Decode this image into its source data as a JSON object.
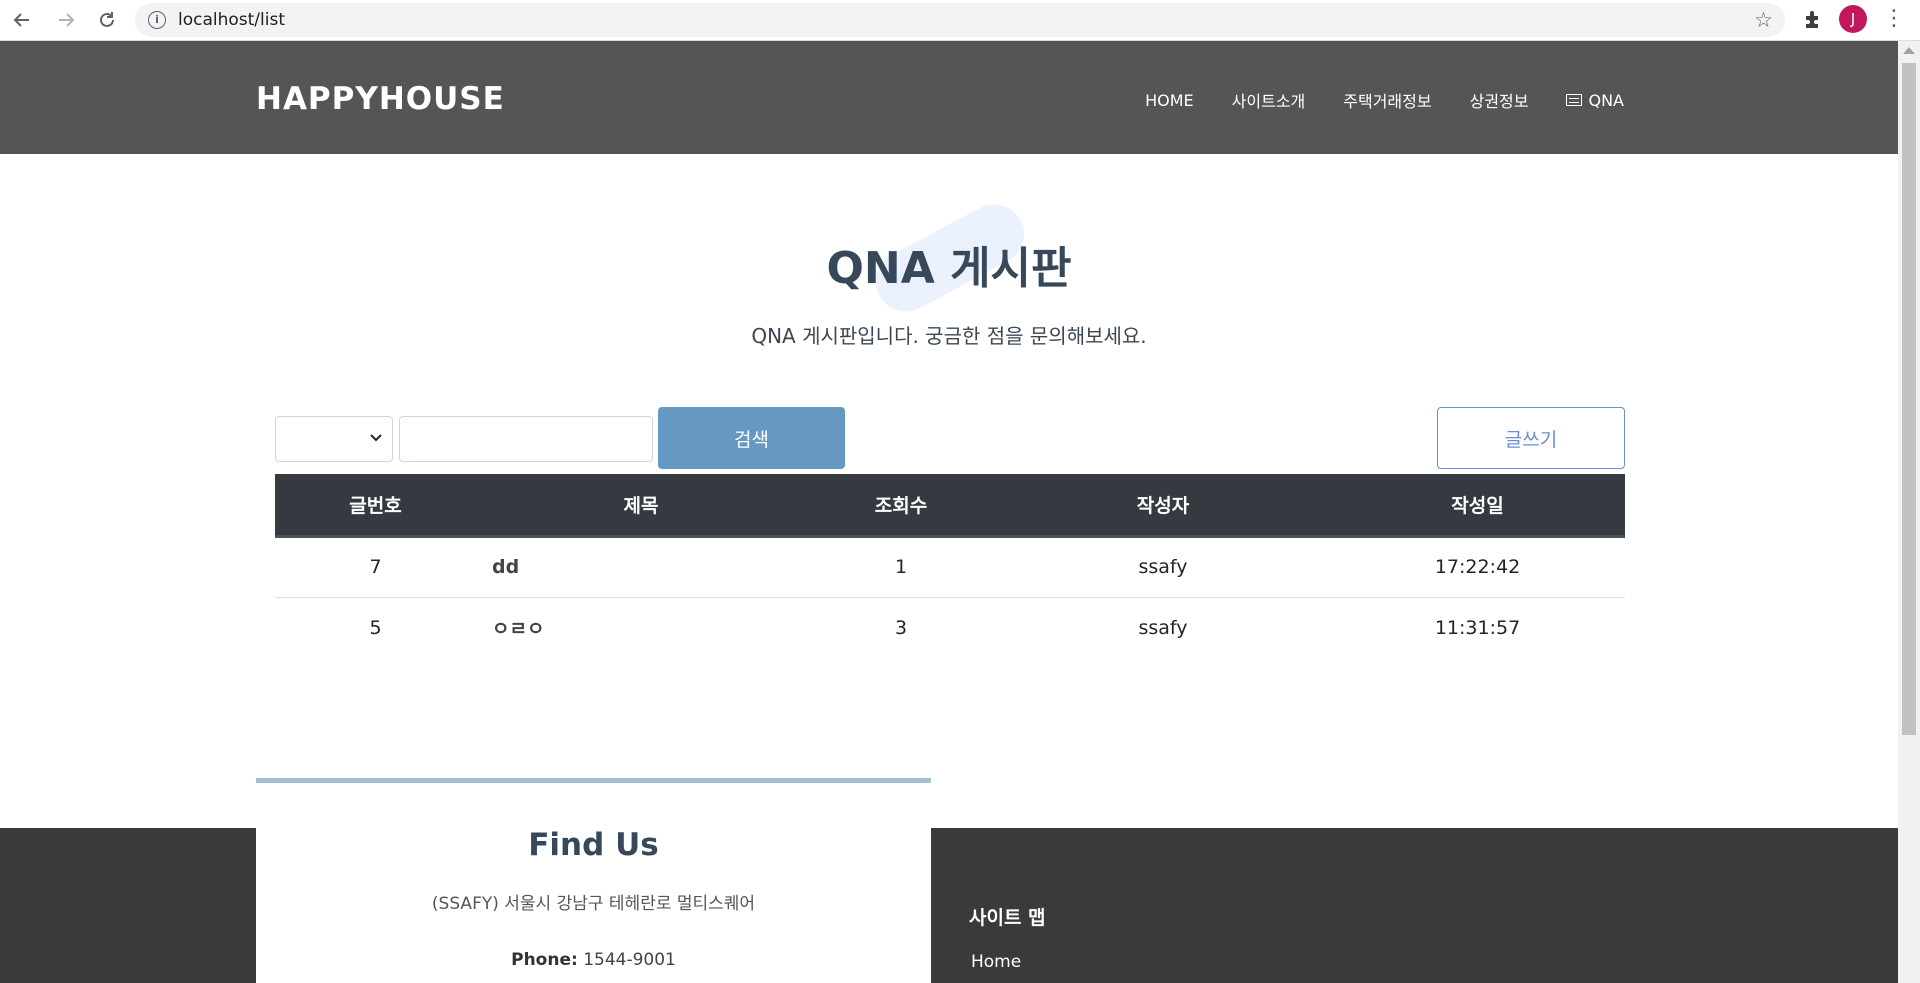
{
  "browser": {
    "url": "localhost/list",
    "profile_initial": "J",
    "icons": [
      "back-icon",
      "forward-icon",
      "reload-icon",
      "info-icon",
      "star-icon",
      "extensions-icon",
      "menu-icon"
    ]
  },
  "header": {
    "brand": "HAPPYHOUSE",
    "menu": [
      {
        "label": "HOME"
      },
      {
        "label": "사이트소개"
      },
      {
        "label": "주택거래정보"
      },
      {
        "label": "상권정보"
      },
      {
        "label": "QNA",
        "icon": "board-icon"
      }
    ]
  },
  "main": {
    "title": "QNA 게시판",
    "subtitle": "QNA 게시판입니다. 궁금한 점을 문의해보세요.",
    "search": {
      "select_value": "",
      "input_value": "",
      "button_label": "검색"
    },
    "write_button_label": "글쓰기",
    "table": {
      "headers": [
        "글번호",
        "제목",
        "조회수",
        "작성자",
        "작성일"
      ],
      "rows": [
        {
          "no": "7",
          "subject": "dd",
          "views": "1",
          "writer": "ssafy",
          "date": "17:22:42"
        },
        {
          "no": "5",
          "subject": "ㅇㄹㅇ",
          "views": "3",
          "writer": "ssafy",
          "date": "11:31:57"
        }
      ]
    }
  },
  "footer": {
    "find_us_title": "Find Us",
    "address": "(SSAFY) 서울시 강남구 테헤란로 멀티스퀘어",
    "phone_label": "Phone:",
    "phone_value": "1544-9001",
    "sitemap_title": "사이트 맵",
    "sitemap_links": [
      "Home"
    ]
  },
  "colors": {
    "header_bg": "#555555",
    "accent_blue": "#6699c2",
    "table_header_bg": "#343a40",
    "footer_bg": "#3a3a3a",
    "avatar_bg": "#c2185b"
  }
}
